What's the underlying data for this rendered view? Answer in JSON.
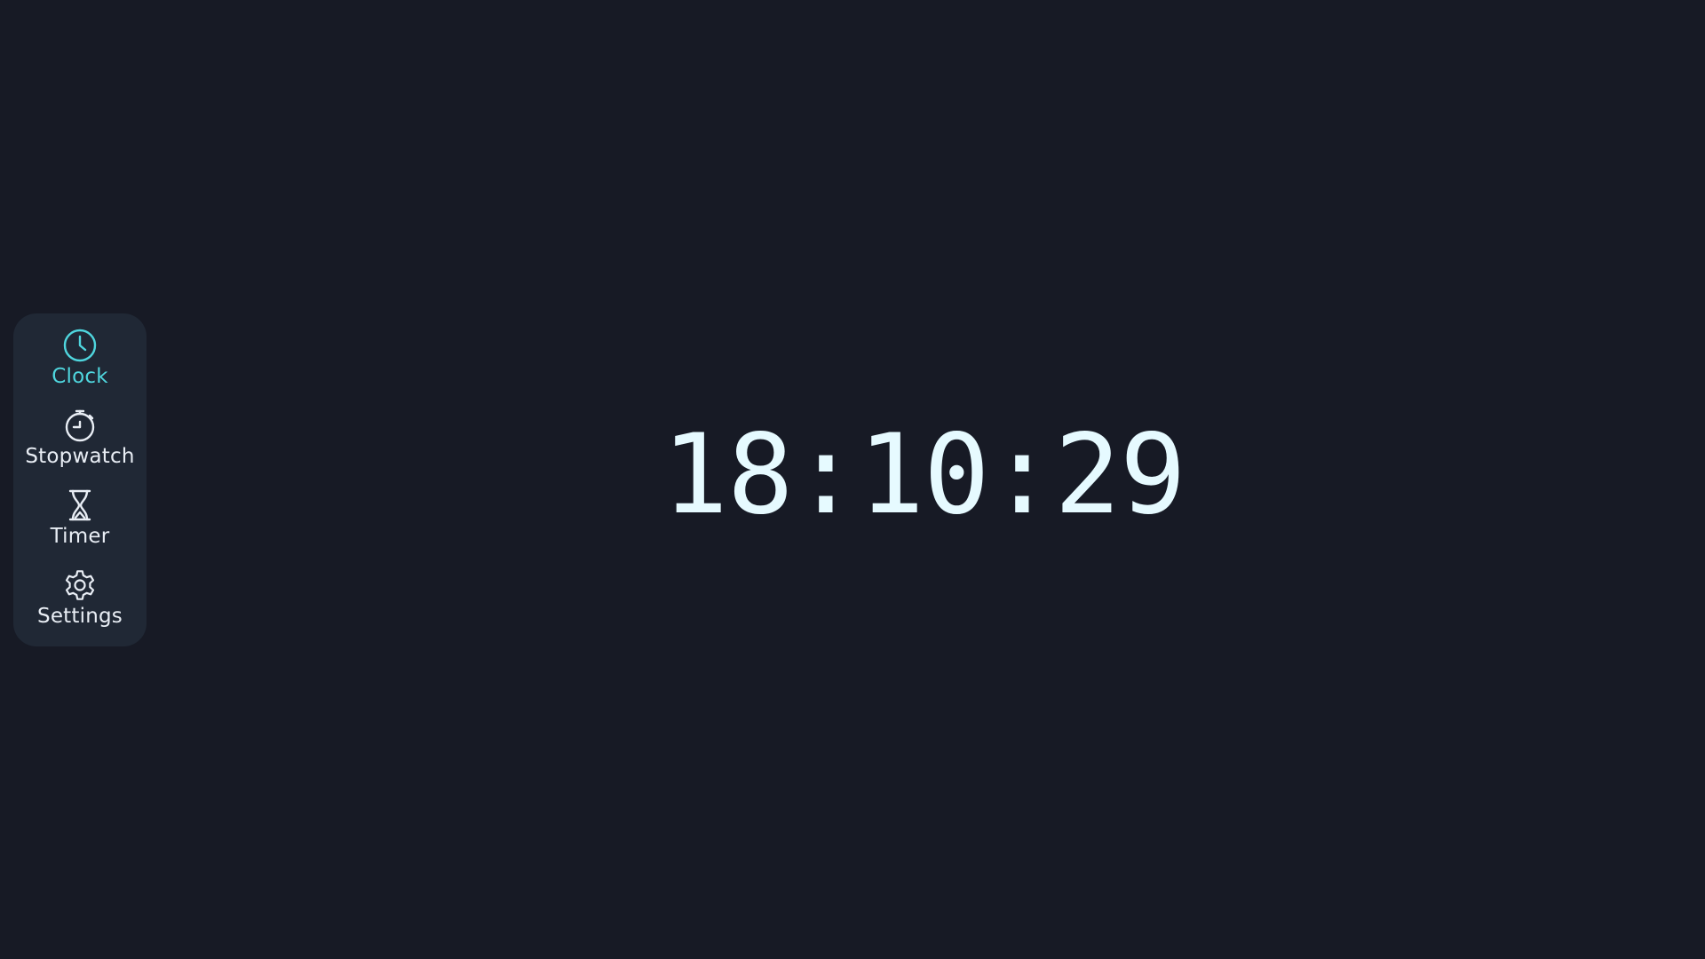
{
  "colors": {
    "background": "#171a25",
    "sidebar_background": "#202835",
    "accent": "#4fd6de",
    "text": "#e9eef5",
    "clock_text": "#e6faff"
  },
  "sidebar": {
    "items": [
      {
        "label": "Clock",
        "icon": "clock-icon",
        "active": true
      },
      {
        "label": "Stopwatch",
        "icon": "stopwatch-icon",
        "active": false
      },
      {
        "label": "Timer",
        "icon": "hourglass-icon",
        "active": false
      },
      {
        "label": "Settings",
        "icon": "gear-icon",
        "active": false
      }
    ]
  },
  "clock": {
    "time": "18:10:29"
  }
}
